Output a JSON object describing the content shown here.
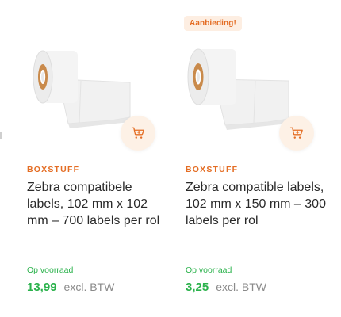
{
  "products": [
    {
      "badge": "",
      "brand": "BOXSTUFF",
      "title": "Zebra compatibele labels, 102 mm x 102 mm – 700 labels per rol",
      "stock": "Op voorraad",
      "price": "13,99",
      "price_note": "excl. BTW",
      "image_icon": "label-roll-image",
      "cart_icon": "add-to-cart-icon"
    },
    {
      "badge": "Aanbieding!",
      "brand": "BOXSTUFF",
      "title": "Zebra compatible labels, 102 mm x 150 mm – 300 labels per rol",
      "stock": "Op voorraad",
      "price": "3,25",
      "price_note": "excl. BTW",
      "image_icon": "label-roll-image",
      "cart_icon": "add-to-cart-icon"
    }
  ],
  "colors": {
    "accent": "#e46d24",
    "badge_bg": "#fdeee2",
    "in_stock": "#2bb24c",
    "muted": "#8a8a8a"
  }
}
